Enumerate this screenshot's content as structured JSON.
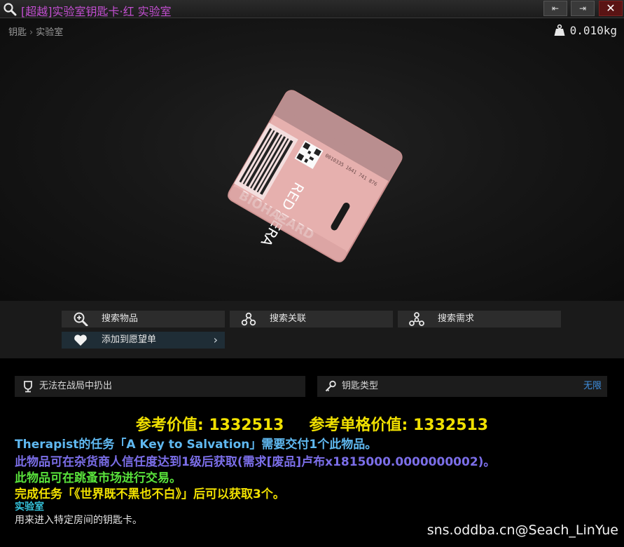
{
  "window": {
    "title": "[超越]实验室钥匙卡·红 实验室",
    "buttons": {
      "prev": "⇤",
      "next": "⇥",
      "close": "✕"
    }
  },
  "preview": {
    "breadcrumb": [
      "钥匙",
      "实验室"
    ],
    "weight": "0.010kg",
    "card_texts": {
      "bottom_text": "RED AERA",
      "side_text": "BIOHAZARD",
      "serial": "0010335 1641 741 876"
    }
  },
  "actions": {
    "search_items": "搜索物品",
    "search_related": "搜索关联",
    "search_requirements": "搜索需求",
    "add_wishlist": "添加到愿望单"
  },
  "info": {
    "no_extract": "无法在战局中扔出",
    "key_type_label": "钥匙类型",
    "key_type_value": "无限"
  },
  "details": {
    "ref_value": "参考价值: 1332513",
    "ref_slot_value": "参考单格价值: 1332513",
    "quest_line": "Therapist的任务「A Key to Salvation」需要交付1个此物品。",
    "trader_line": "此物品可在杂货商人信任度达到1级后获取(需求[废品]卢布x1815000.0000000002)。",
    "flea_line": "此物品可在跳蚤市场进行交易。",
    "quest_reward_line": "完成任务「《世界既不黑也不白》」后可以获取3个。",
    "location": "实验室",
    "description": "用来进入特定房间的钥匙卡。"
  },
  "watermark": "sns.oddba.cn@Seach_LinYue",
  "colors": {
    "title": "#c24fd0",
    "price": "#f0e000",
    "quest": "#5fb8f0",
    "trader": "#7b6ee8",
    "flea": "#59e23b",
    "location": "#34c0d8",
    "key_type_value": "#3f8fe0",
    "card_pink": "#e8b2b2"
  },
  "icons": [
    "search-icon",
    "weight-icon",
    "zoom-search-icon",
    "link-nodes-icon",
    "tree-nodes-icon",
    "heart-icon",
    "no-extract-icon",
    "key-icon"
  ]
}
